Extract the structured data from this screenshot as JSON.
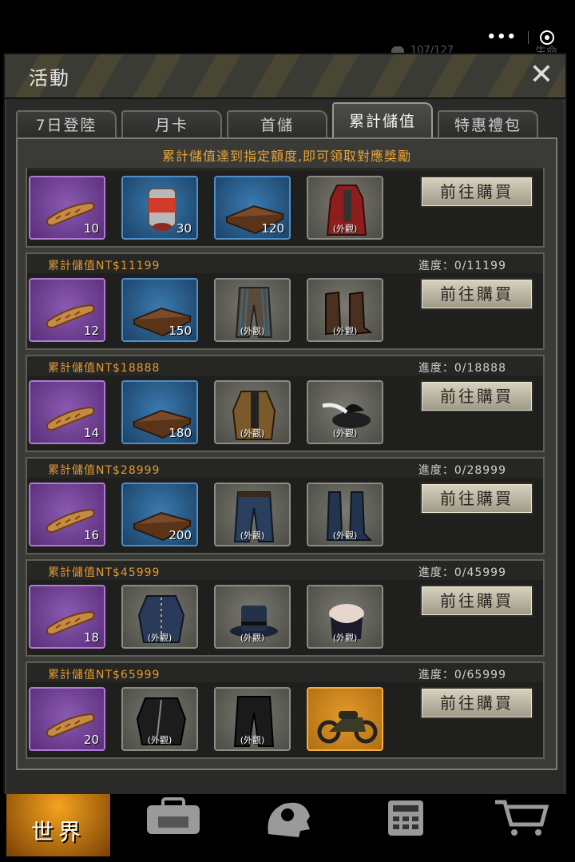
{
  "dialog": {
    "title": "活動",
    "close_icon": "close-icon",
    "notice": "累計儲值達到指定額度,即可領取對應獎勵"
  },
  "tabs": [
    {
      "label": "7日登陸"
    },
    {
      "label": "月卡"
    },
    {
      "label": "首儲"
    },
    {
      "label": "累計儲值",
      "active": true
    },
    {
      "label": "特惠禮包"
    }
  ],
  "buy_label": "前往購買",
  "look_label": "(外觀)",
  "rows": [
    {
      "label": "",
      "progress": "",
      "items": [
        {
          "icon": "bread-icon",
          "color": "purple",
          "qty": "10"
        },
        {
          "icon": "meat-can-icon",
          "color": "blue",
          "qty": "30"
        },
        {
          "icon": "book-icon",
          "color": "blue",
          "qty": "120"
        },
        {
          "icon": "red-coat-icon",
          "color": "grey",
          "look": "(外觀)"
        }
      ]
    },
    {
      "label": "累計儲值NT$11199",
      "progress": "進度：0/11199",
      "items": [
        {
          "icon": "bread-icon",
          "color": "purple",
          "qty": "12"
        },
        {
          "icon": "book-icon",
          "color": "blue",
          "qty": "150"
        },
        {
          "icon": "striped-pants-icon",
          "color": "grey",
          "look": "(外觀)"
        },
        {
          "icon": "boots-icon",
          "color": "grey",
          "look": "(外觀)"
        }
      ]
    },
    {
      "label": "累計儲值NT$18888",
      "progress": "進度：0/18888",
      "items": [
        {
          "icon": "bread-icon",
          "color": "purple",
          "qty": "14"
        },
        {
          "icon": "book-icon",
          "color": "blue",
          "qty": "180"
        },
        {
          "icon": "jacket-icon",
          "color": "grey",
          "look": "(外觀)"
        },
        {
          "icon": "feather-hat-icon",
          "color": "grey",
          "look": "(外觀)"
        }
      ]
    },
    {
      "label": "累計儲值NT$28999",
      "progress": "進度：0/28999",
      "items": [
        {
          "icon": "bread-icon",
          "color": "purple",
          "qty": "16"
        },
        {
          "icon": "book-icon",
          "color": "blue",
          "qty": "200"
        },
        {
          "icon": "jeans-icon",
          "color": "grey",
          "look": "(外觀)"
        },
        {
          "icon": "high-boots-icon",
          "color": "grey",
          "look": "(外觀)"
        }
      ]
    },
    {
      "label": "累計儲值NT$45999",
      "progress": "進度：0/45999",
      "items": [
        {
          "icon": "bread-icon",
          "color": "purple",
          "qty": "18"
        },
        {
          "icon": "blue-jacket-icon",
          "color": "grey",
          "look": "(外觀)"
        },
        {
          "icon": "top-hat-icon",
          "color": "grey",
          "look": "(外觀)"
        },
        {
          "icon": "corset-icon",
          "color": "grey",
          "look": "(外觀)"
        }
      ]
    },
    {
      "label": "累計儲值NT$65999",
      "progress": "進度：0/65999",
      "items": [
        {
          "icon": "bread-icon",
          "color": "purple",
          "qty": "20"
        },
        {
          "icon": "leather-jacket-icon",
          "color": "grey",
          "look": "(外觀)"
        },
        {
          "icon": "leather-pants-icon",
          "color": "grey",
          "look": "(外觀)"
        },
        {
          "icon": "motorcycle-icon",
          "color": "gold"
        }
      ]
    }
  ],
  "bottom_nav": {
    "world_label": "世界",
    "icons": [
      "backpack-icon",
      "head-gear-icon",
      "calculator-icon",
      "cart-icon"
    ]
  },
  "hud": {
    "life_text": "生命",
    "hp_text": "107/127"
  }
}
